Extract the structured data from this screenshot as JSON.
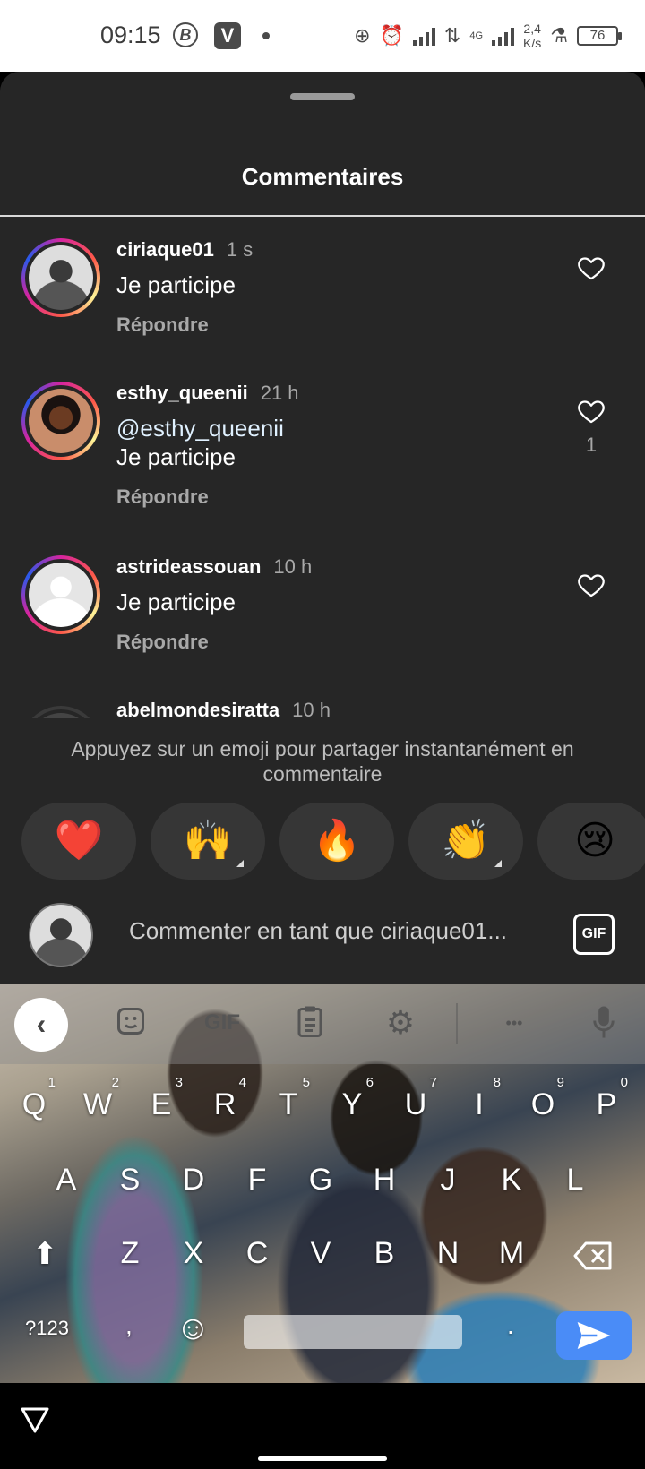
{
  "status_bar": {
    "time": "09:15",
    "icons": [
      "b-badge-icon",
      "v-app-icon",
      "dot",
      "add-circle-icon",
      "alarm-icon",
      "signal-icon",
      "data-arrows-icon",
      "signal-4g-icon",
      "beaker-icon",
      "battery-icon"
    ],
    "network_label": "4G",
    "speed_value": "2,4",
    "speed_unit": "K/s",
    "battery": "76"
  },
  "sheet": {
    "title": "Commentaires"
  },
  "comments": [
    {
      "username": "ciriaque01",
      "time": "1 s",
      "text_lines": [
        "Je participe"
      ],
      "reply_label": "Répondre",
      "likes": ""
    },
    {
      "username": "esthy_queenii",
      "time": "21 h",
      "text_lines": [
        "@esthy_queenii",
        "Je participe"
      ],
      "reply_label": "Répondre",
      "likes": "1"
    },
    {
      "username": "astrideassouan",
      "time": "10 h",
      "text_lines": [
        "Je participe"
      ],
      "reply_label": "Répondre",
      "likes": ""
    },
    {
      "username": "abelmondesiratta",
      "time": "10 h"
    }
  ],
  "emoji_hint": "Appuyez sur un emoji pour partager instantanément en commentaire",
  "emojis": [
    "❤️",
    "🙌",
    "🔥",
    "👏",
    "😢"
  ],
  "composer": {
    "placeholder": "Commenter en tant que ciriaque01...",
    "gif_label": "GIF"
  },
  "keyboard": {
    "toolbar": {
      "gif_label": "GIF",
      "more_label": "•••"
    },
    "row1": [
      {
        "k": "Q",
        "n": "1"
      },
      {
        "k": "W",
        "n": "2"
      },
      {
        "k": "E",
        "n": "3"
      },
      {
        "k": "R",
        "n": "4"
      },
      {
        "k": "T",
        "n": "5"
      },
      {
        "k": "Y",
        "n": "6"
      },
      {
        "k": "U",
        "n": "7"
      },
      {
        "k": "I",
        "n": "8"
      },
      {
        "k": "O",
        "n": "9"
      },
      {
        "k": "P",
        "n": "0"
      }
    ],
    "row2": [
      "A",
      "S",
      "D",
      "F",
      "G",
      "H",
      "J",
      "K",
      "L"
    ],
    "row3": [
      "Z",
      "X",
      "C",
      "V",
      "B",
      "N",
      "M"
    ],
    "symbols_label": "?123",
    "comma_label": ",",
    "period_label": "."
  },
  "colors": {
    "sheet_bg": "#262626",
    "send_key": "#4a8cf7",
    "secondary_text": "#a8a8a8"
  }
}
